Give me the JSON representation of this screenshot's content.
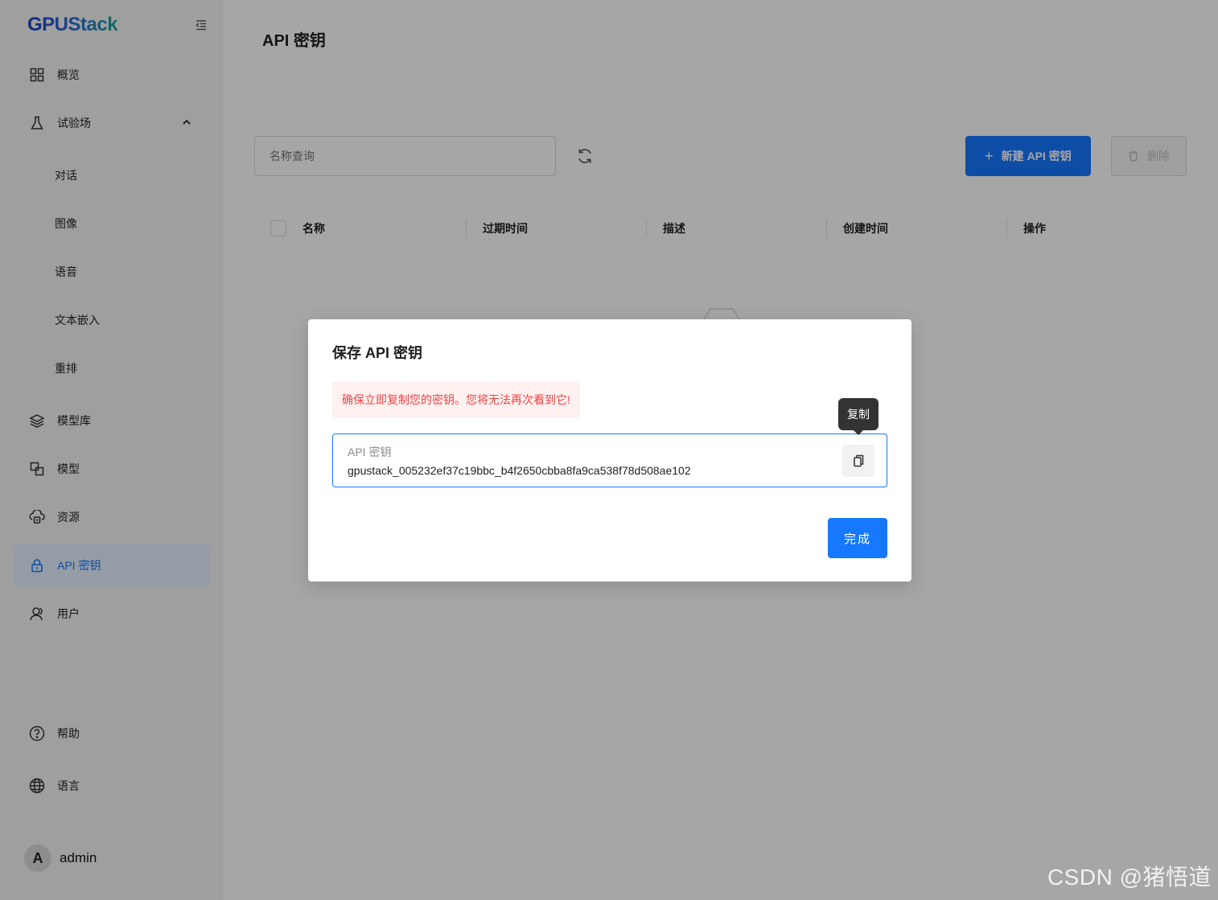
{
  "app": {
    "brand": "GPUStack"
  },
  "sidebar": {
    "items": [
      {
        "label": "概览",
        "icon": "dashboard-icon"
      },
      {
        "label": "试验场",
        "icon": "flask-icon",
        "expanded": true
      },
      {
        "label": "对话",
        "sub": true
      },
      {
        "label": "图像",
        "sub": true
      },
      {
        "label": "语音",
        "sub": true
      },
      {
        "label": "文本嵌入",
        "sub": true
      },
      {
        "label": "重排",
        "sub": true
      },
      {
        "label": "模型库",
        "icon": "layers-icon"
      },
      {
        "label": "模型",
        "icon": "model-icon"
      },
      {
        "label": "资源",
        "icon": "resources-icon"
      },
      {
        "label": "API 密钥",
        "icon": "lock-icon",
        "active": true
      },
      {
        "label": "用户",
        "icon": "users-icon"
      }
    ],
    "help": "帮助",
    "language": "语言",
    "user": {
      "avatar_letter": "A",
      "name": "admin"
    }
  },
  "main": {
    "title": "API 密钥",
    "search_placeholder": "名称查询",
    "new_button": "新建 API 密钥",
    "delete_button": "删除",
    "columns": [
      "名称",
      "过期时间",
      "描述",
      "创建时间",
      "操作"
    ]
  },
  "modal": {
    "title": "保存 API 密钥",
    "warning": "确保立即复制您的密钥。您将无法再次看到它!",
    "key_label": "API 密钥",
    "key_value": "gpustack_005232ef37c19bbc_b4f2650cbba8fa9ca538f78d508ae102",
    "copy_tooltip": "复制",
    "done_button": "完成"
  },
  "watermark": "CSDN @猪悟道",
  "colors": {
    "primary": "#1677ff",
    "warning_text": "#ef4444",
    "warning_bg": "#fff1f0"
  }
}
